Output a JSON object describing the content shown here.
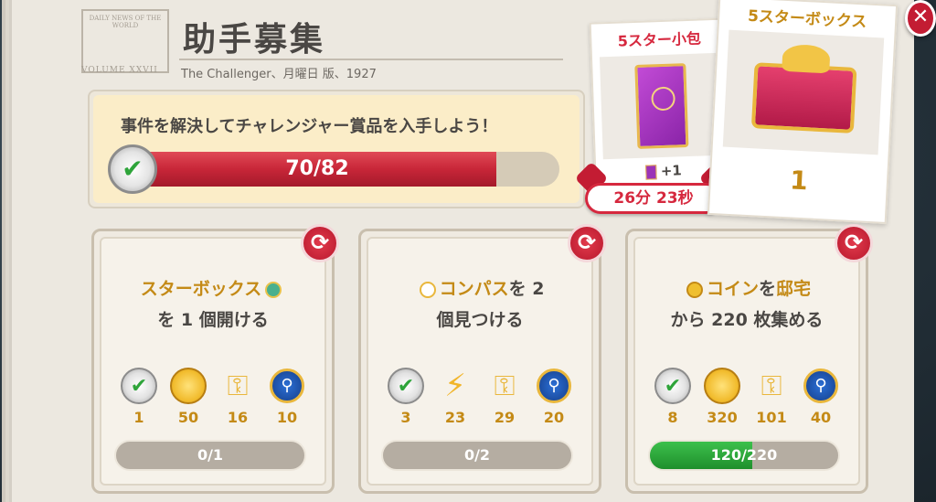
{
  "header": {
    "title": "助手募集",
    "subtitle": "The Challenger、月曜日 版、1927",
    "masthead_text": "DAILY NEWS OF THE WORLD",
    "volume_text": "VOLUME XXVII"
  },
  "banner": {
    "text": "事件を解決してチャレンジャー賞品を入手しよう！",
    "progress_text": "70/82",
    "progress_current": 70,
    "progress_total": 82
  },
  "rewards": {
    "pack": {
      "title": "5スター小包",
      "plus_text": "+1",
      "timer": "26分 23秒"
    },
    "box": {
      "title": "5スターボックス",
      "count": "1"
    }
  },
  "tasks": [
    {
      "line1_hl": "スターボックス",
      "line1_rest": "",
      "line2": "を 1 個開ける",
      "icon": "star-box-icon",
      "rewards": [
        "1",
        "50",
        "16",
        "10"
      ],
      "reward_icons": [
        "check-badge-icon",
        "coin-icon",
        "key-icon",
        "magnifier-icon"
      ],
      "progress_text": "0/1",
      "progress_fraction": 0.0
    },
    {
      "line1_hl": "コンパス",
      "line1_rest": "を 2",
      "line2": "個見つける",
      "icon": "compass-icon",
      "rewards": [
        "3",
        "23",
        "29",
        "20"
      ],
      "reward_icons": [
        "check-badge-icon",
        "lightning-icon",
        "key-icon",
        "magnifier-icon"
      ],
      "progress_text": "0/2",
      "progress_fraction": 0.0
    },
    {
      "line1_hl": "コイン",
      "line1_mid": "を",
      "line1_hl2": "邸宅",
      "line2": "から 220 枚集める",
      "icon": "coin-icon",
      "rewards": [
        "8",
        "320",
        "101",
        "40"
      ],
      "reward_icons": [
        "check-badge-icon",
        "coin-icon",
        "key-icon",
        "magnifier-icon"
      ],
      "progress_text": "120/220",
      "progress_fraction": 0.545
    }
  ],
  "colors": {
    "accent_red": "#c82638",
    "gold": "#c48a16",
    "green": "#2ea43a"
  }
}
